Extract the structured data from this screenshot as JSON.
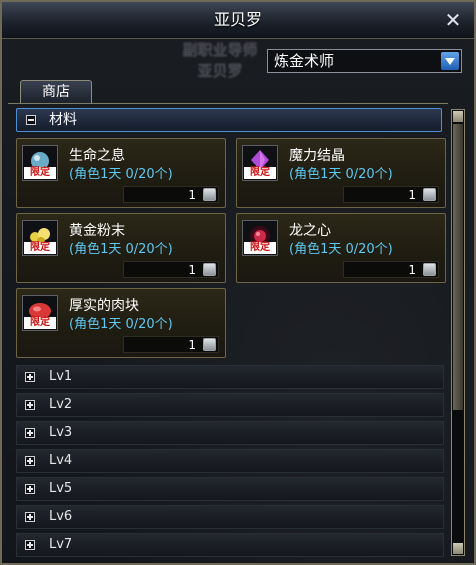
{
  "window": {
    "title": "亚贝罗",
    "close_glyph": "✕"
  },
  "watermark": {
    "line1": "副职业导师",
    "line2": "亚贝罗"
  },
  "job_select": {
    "selected": "炼金术师"
  },
  "tabs": [
    {
      "label": "商店"
    }
  ],
  "section": {
    "label": "材料",
    "expanded": true
  },
  "items": [
    {
      "name": "生命之息",
      "limit": "(角色1天 0/20个)",
      "quantity": "1",
      "badge": "限定",
      "icon": "potion-icon",
      "color": "#78c8e8"
    },
    {
      "name": "魔力结晶",
      "limit": "(角色1天 0/20个)",
      "quantity": "1",
      "badge": "限定",
      "icon": "crystal-icon",
      "color": "#b04ad8"
    },
    {
      "name": "黄金粉末",
      "limit": "(角色1天 0/20个)",
      "quantity": "1",
      "badge": "限定",
      "icon": "gold-powder-icon",
      "color": "#e8d040"
    },
    {
      "name": "龙之心",
      "limit": "(角色1天 0/20个)",
      "quantity": "1",
      "badge": "限定",
      "icon": "dragon-heart-icon",
      "color": "#d02848"
    },
    {
      "name": "厚实的肉块",
      "limit": "(角色1天 0/20个)",
      "quantity": "1",
      "badge": "限定",
      "icon": "meat-icon",
      "color": "#d83838"
    }
  ],
  "levels": [
    {
      "label": "Lv1"
    },
    {
      "label": "Lv2"
    },
    {
      "label": "Lv3"
    },
    {
      "label": "Lv4"
    },
    {
      "label": "Lv5"
    },
    {
      "label": "Lv6"
    },
    {
      "label": "Lv7"
    }
  ]
}
